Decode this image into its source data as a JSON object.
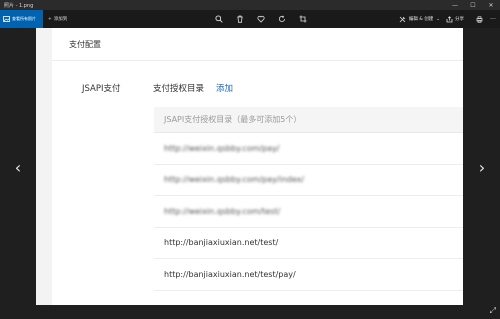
{
  "window": {
    "title": "照片 - 1.png",
    "controls": {
      "minimize": "—",
      "maximize": "☐",
      "close": "✕"
    }
  },
  "toolbar": {
    "view_all_label": "查看所有照片",
    "add_label": "添加到",
    "center_icons": [
      "zoom-icon",
      "delete-icon",
      "favorite-icon",
      "rotate-icon",
      "crop-icon"
    ],
    "edit_label": "编辑 & 创建",
    "share_label": "分享",
    "accent": "#0063b1"
  },
  "photo": {
    "panel_title": "支付配置",
    "row_label": "JSAPI支付",
    "sub_label": "支付授权目录",
    "add_link": "添加",
    "table_header": "JSAPI支付授权目录（最多可添加5个）",
    "rows": [
      {
        "text": "http://weixin.qsbby.com/pay/",
        "blurred": true
      },
      {
        "text": "http://weixin.qsbby.com/pay/index/",
        "blurred": true
      },
      {
        "text": "http://weixin.qsbby.com/test/",
        "blurred": true
      },
      {
        "text": "http://banjiaxiuxian.net/test/",
        "blurred": false
      },
      {
        "text": "http://banjiaxiuxian.net/test/pay/",
        "blurred": false
      }
    ]
  },
  "navigation": {
    "prev": "‹",
    "next": "›",
    "expand": "⤢"
  }
}
